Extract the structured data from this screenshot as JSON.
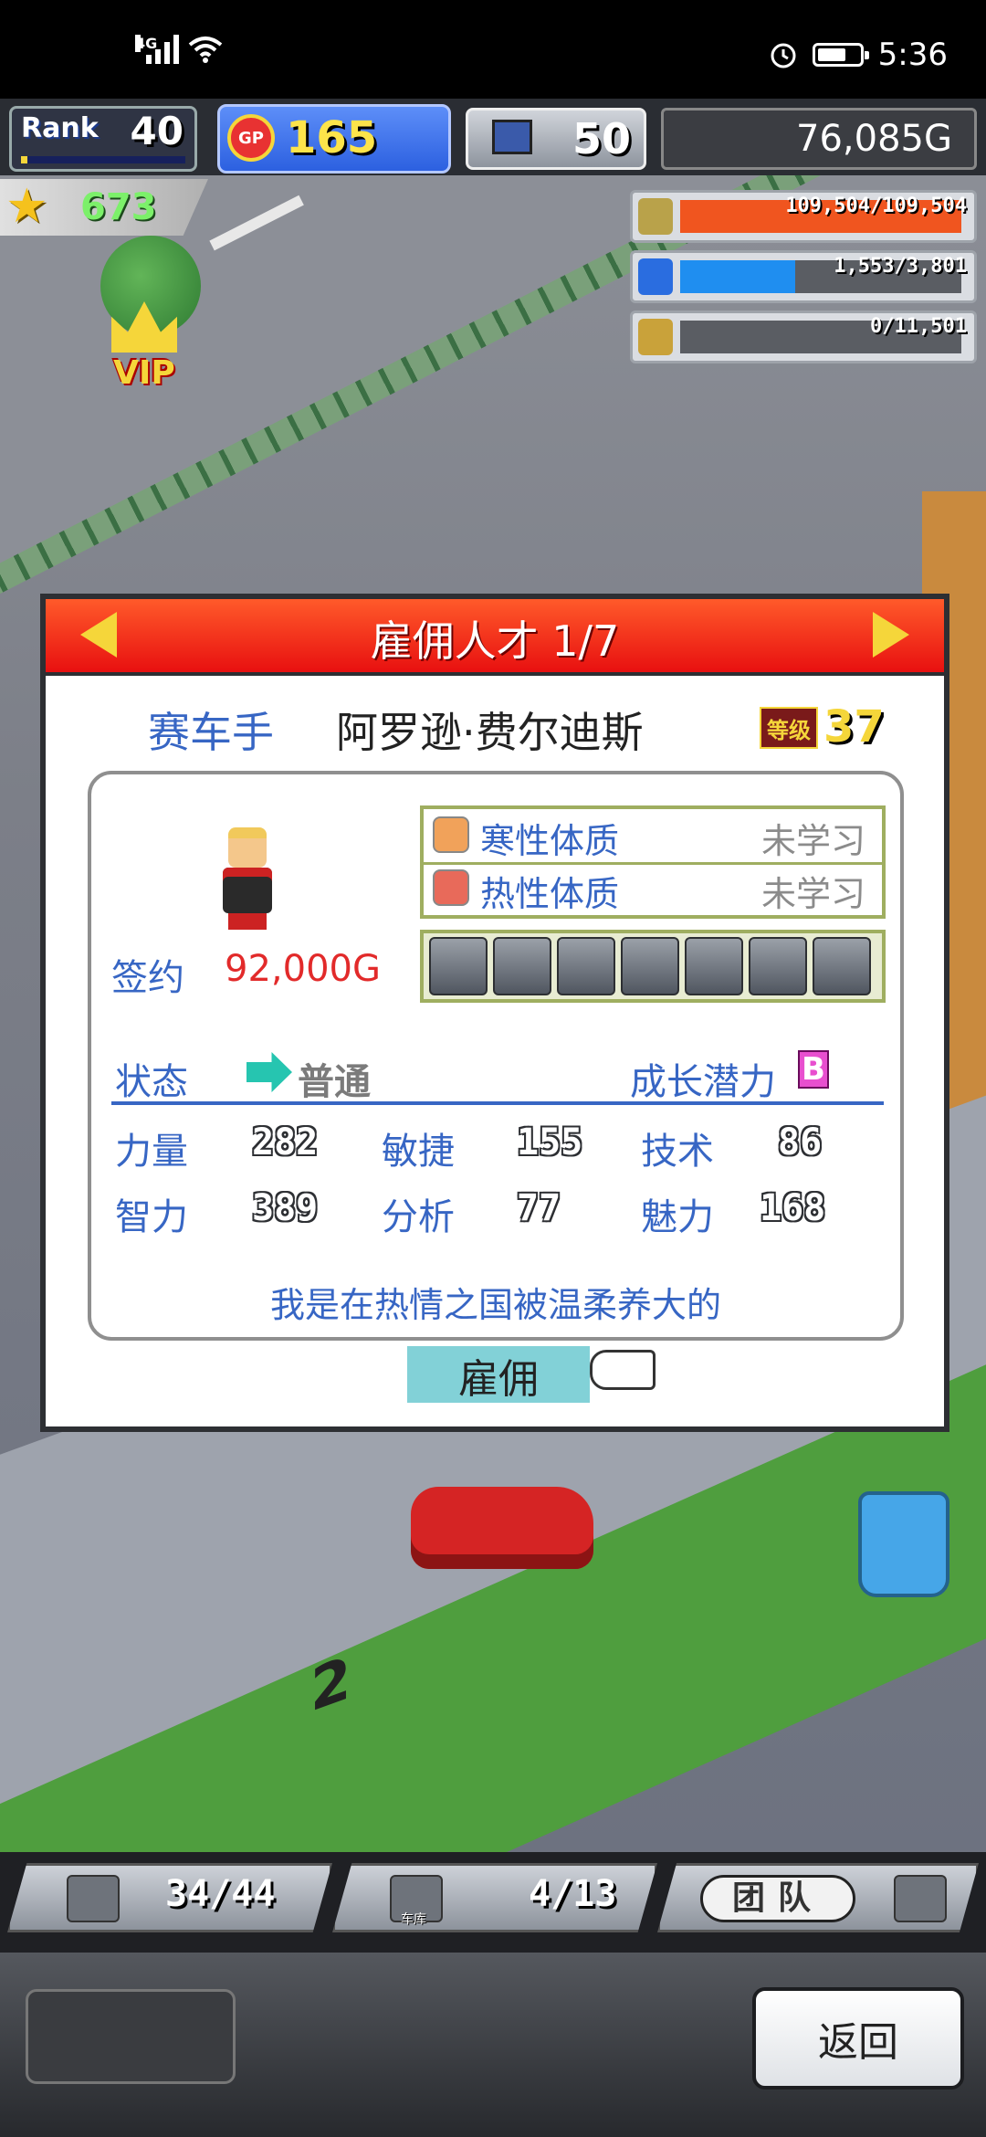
{
  "status_bar": {
    "network": "4G",
    "time": "5:36",
    "icons": [
      "signal-icon",
      "wifi-icon",
      "alarm-icon",
      "battery-icon"
    ]
  },
  "hud": {
    "rank_label": "Rank",
    "rank_value": "40",
    "rank_progress": 0.04,
    "gp_label": "GP",
    "gp_value": "165",
    "pc_value": "50",
    "money": "76,085G",
    "stars": "673",
    "resources": [
      {
        "name": "fuel",
        "text": "109,504/109,504",
        "fill": 1.0,
        "color": "#f0551f"
      },
      {
        "name": "water",
        "text": "1,553/3,801",
        "fill": 0.41,
        "color": "#1f8ef0"
      },
      {
        "name": "feather",
        "text": "0/11,501",
        "fill": 0.0,
        "color": "#c9c9c9"
      }
    ],
    "vip_label": "VIP"
  },
  "dialog": {
    "title": "雇佣人才 1/7",
    "role": "赛车手",
    "name": "阿罗逊·费尔迪斯",
    "level_tag": "等级",
    "level": "37",
    "sign_label": "签约",
    "sign_value": "92,000G",
    "traits": [
      {
        "name": "寒性体质",
        "state": "未学习"
      },
      {
        "name": "热性体质",
        "state": "未学习"
      }
    ],
    "skill_slots": 7,
    "status_label": "状态",
    "status_value": "普通",
    "growth_label": "成长潜力",
    "growth_value": "B",
    "stats": [
      {
        "label": "力量",
        "value": "282"
      },
      {
        "label": "敏捷",
        "value": "155"
      },
      {
        "label": "技术",
        "value": "86"
      },
      {
        "label": "智力",
        "value": "389"
      },
      {
        "label": "分析",
        "value": "77"
      },
      {
        "label": "魅力",
        "value": "168"
      }
    ],
    "quote": "我是在热情之国被温柔养大的",
    "hire_label": "雇佣"
  },
  "bottom": {
    "slots_value": "34/44",
    "garage_value": "4/13",
    "garage_label": "车库",
    "team_label": "团队",
    "back_label": "返回"
  }
}
